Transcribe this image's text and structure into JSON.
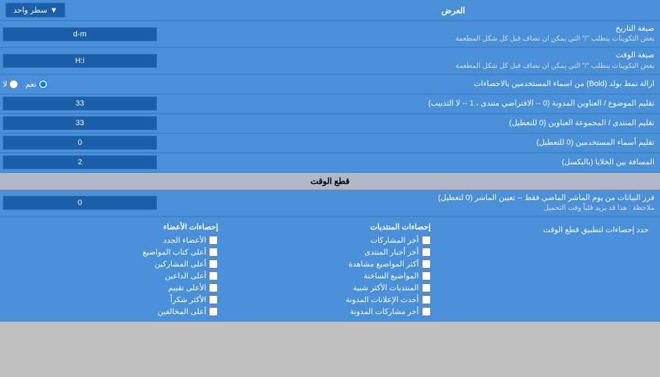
{
  "header": {
    "label": "العرض",
    "dropdown_label": "سطر واحد",
    "dropdown_arrow": "▼"
  },
  "rows": [
    {
      "id": "date_format",
      "label_main": "صيغة التاريخ",
      "label_sub": "بعض التكوينات يتطلب \"/\" التي يمكن ان تضاف قبل كل شكل المطعمة",
      "value": "d-m",
      "type": "input"
    },
    {
      "id": "time_format",
      "label_main": "صيغة الوقت",
      "label_sub": "بعض التكوينات يتطلب \"/\" التي يمكن ان تضاف قبل كل شكل المطعمة",
      "value": "H:i",
      "type": "input"
    },
    {
      "id": "bold_remove",
      "label": "ازالة نمط بولد (Bold) من اسماء المستخدمين بالاحصاءات",
      "type": "radio",
      "options": [
        {
          "value": "yes",
          "label": "نعم"
        },
        {
          "value": "no",
          "label": "لا"
        }
      ],
      "selected": "yes"
    },
    {
      "id": "topics_titles",
      "label": "تقليم الموضوع / العناوين المدونة (0 -- الافتراضي متندى ، 1 -- لا التذبيب)",
      "value": "33",
      "type": "input"
    },
    {
      "id": "forum_titles",
      "label": "تقليم المنتدى / المجموعة العناوين (0 للتعطيل)",
      "value": "33",
      "type": "input"
    },
    {
      "id": "usernames",
      "label": "تقليم أسماء المستخدمين (0 للتعطيل)",
      "value": "0",
      "type": "input"
    },
    {
      "id": "space_cells",
      "label": "المسافة بين الخلايا (بالبكسل)",
      "value": "2",
      "type": "input"
    }
  ],
  "cutoff_section": {
    "title": "قطع الوقت",
    "row": {
      "id": "cutoff_days",
      "label_main": "فرز البيانات من يوم الماشر الماضي فقط -- تعيين الماشر (0 لتعطيل)",
      "label_note": "ملاحظة : هذا قد يزيد قلياً وقت التحميل",
      "value": "0",
      "type": "input"
    },
    "apply_label": "حدد إحصاءات لتطبيق قطع الوقت"
  },
  "checkboxes": {
    "col1": {
      "title": "إحصاءات المنتديات",
      "items": [
        {
          "id": "last_posts",
          "label": "أخر المشاركات"
        },
        {
          "id": "last_news",
          "label": "أخر أخبار المنتدى"
        },
        {
          "id": "most_viewed",
          "label": "أكثر المواضيع مشاهدة"
        },
        {
          "id": "hot_topics",
          "label": "المواضيع الساخنة"
        },
        {
          "id": "similar_forums",
          "label": "المنتديات الأكثر شبية"
        },
        {
          "id": "last_announcements",
          "label": "أحدث الإعلانات المدونة"
        },
        {
          "id": "last_pinned",
          "label": "أخر مشاركات المدونة"
        }
      ]
    },
    "col2": {
      "title": "إحصاءات الأعضاء",
      "items": [
        {
          "id": "new_members",
          "label": "الأعضاء الجدد"
        },
        {
          "id": "top_posters",
          "label": "أعلى كتاب المواضيع"
        },
        {
          "id": "top_posters_sub",
          "label": "أعلى المشاركين"
        },
        {
          "id": "top_online",
          "label": "أعلى الداعين"
        },
        {
          "id": "top_rated",
          "label": "الأعلى تقييم"
        },
        {
          "id": "most_thanks",
          "label": "الأكثر شكراً"
        },
        {
          "id": "top_moderators",
          "label": "أعلى المخالفين"
        }
      ]
    }
  }
}
